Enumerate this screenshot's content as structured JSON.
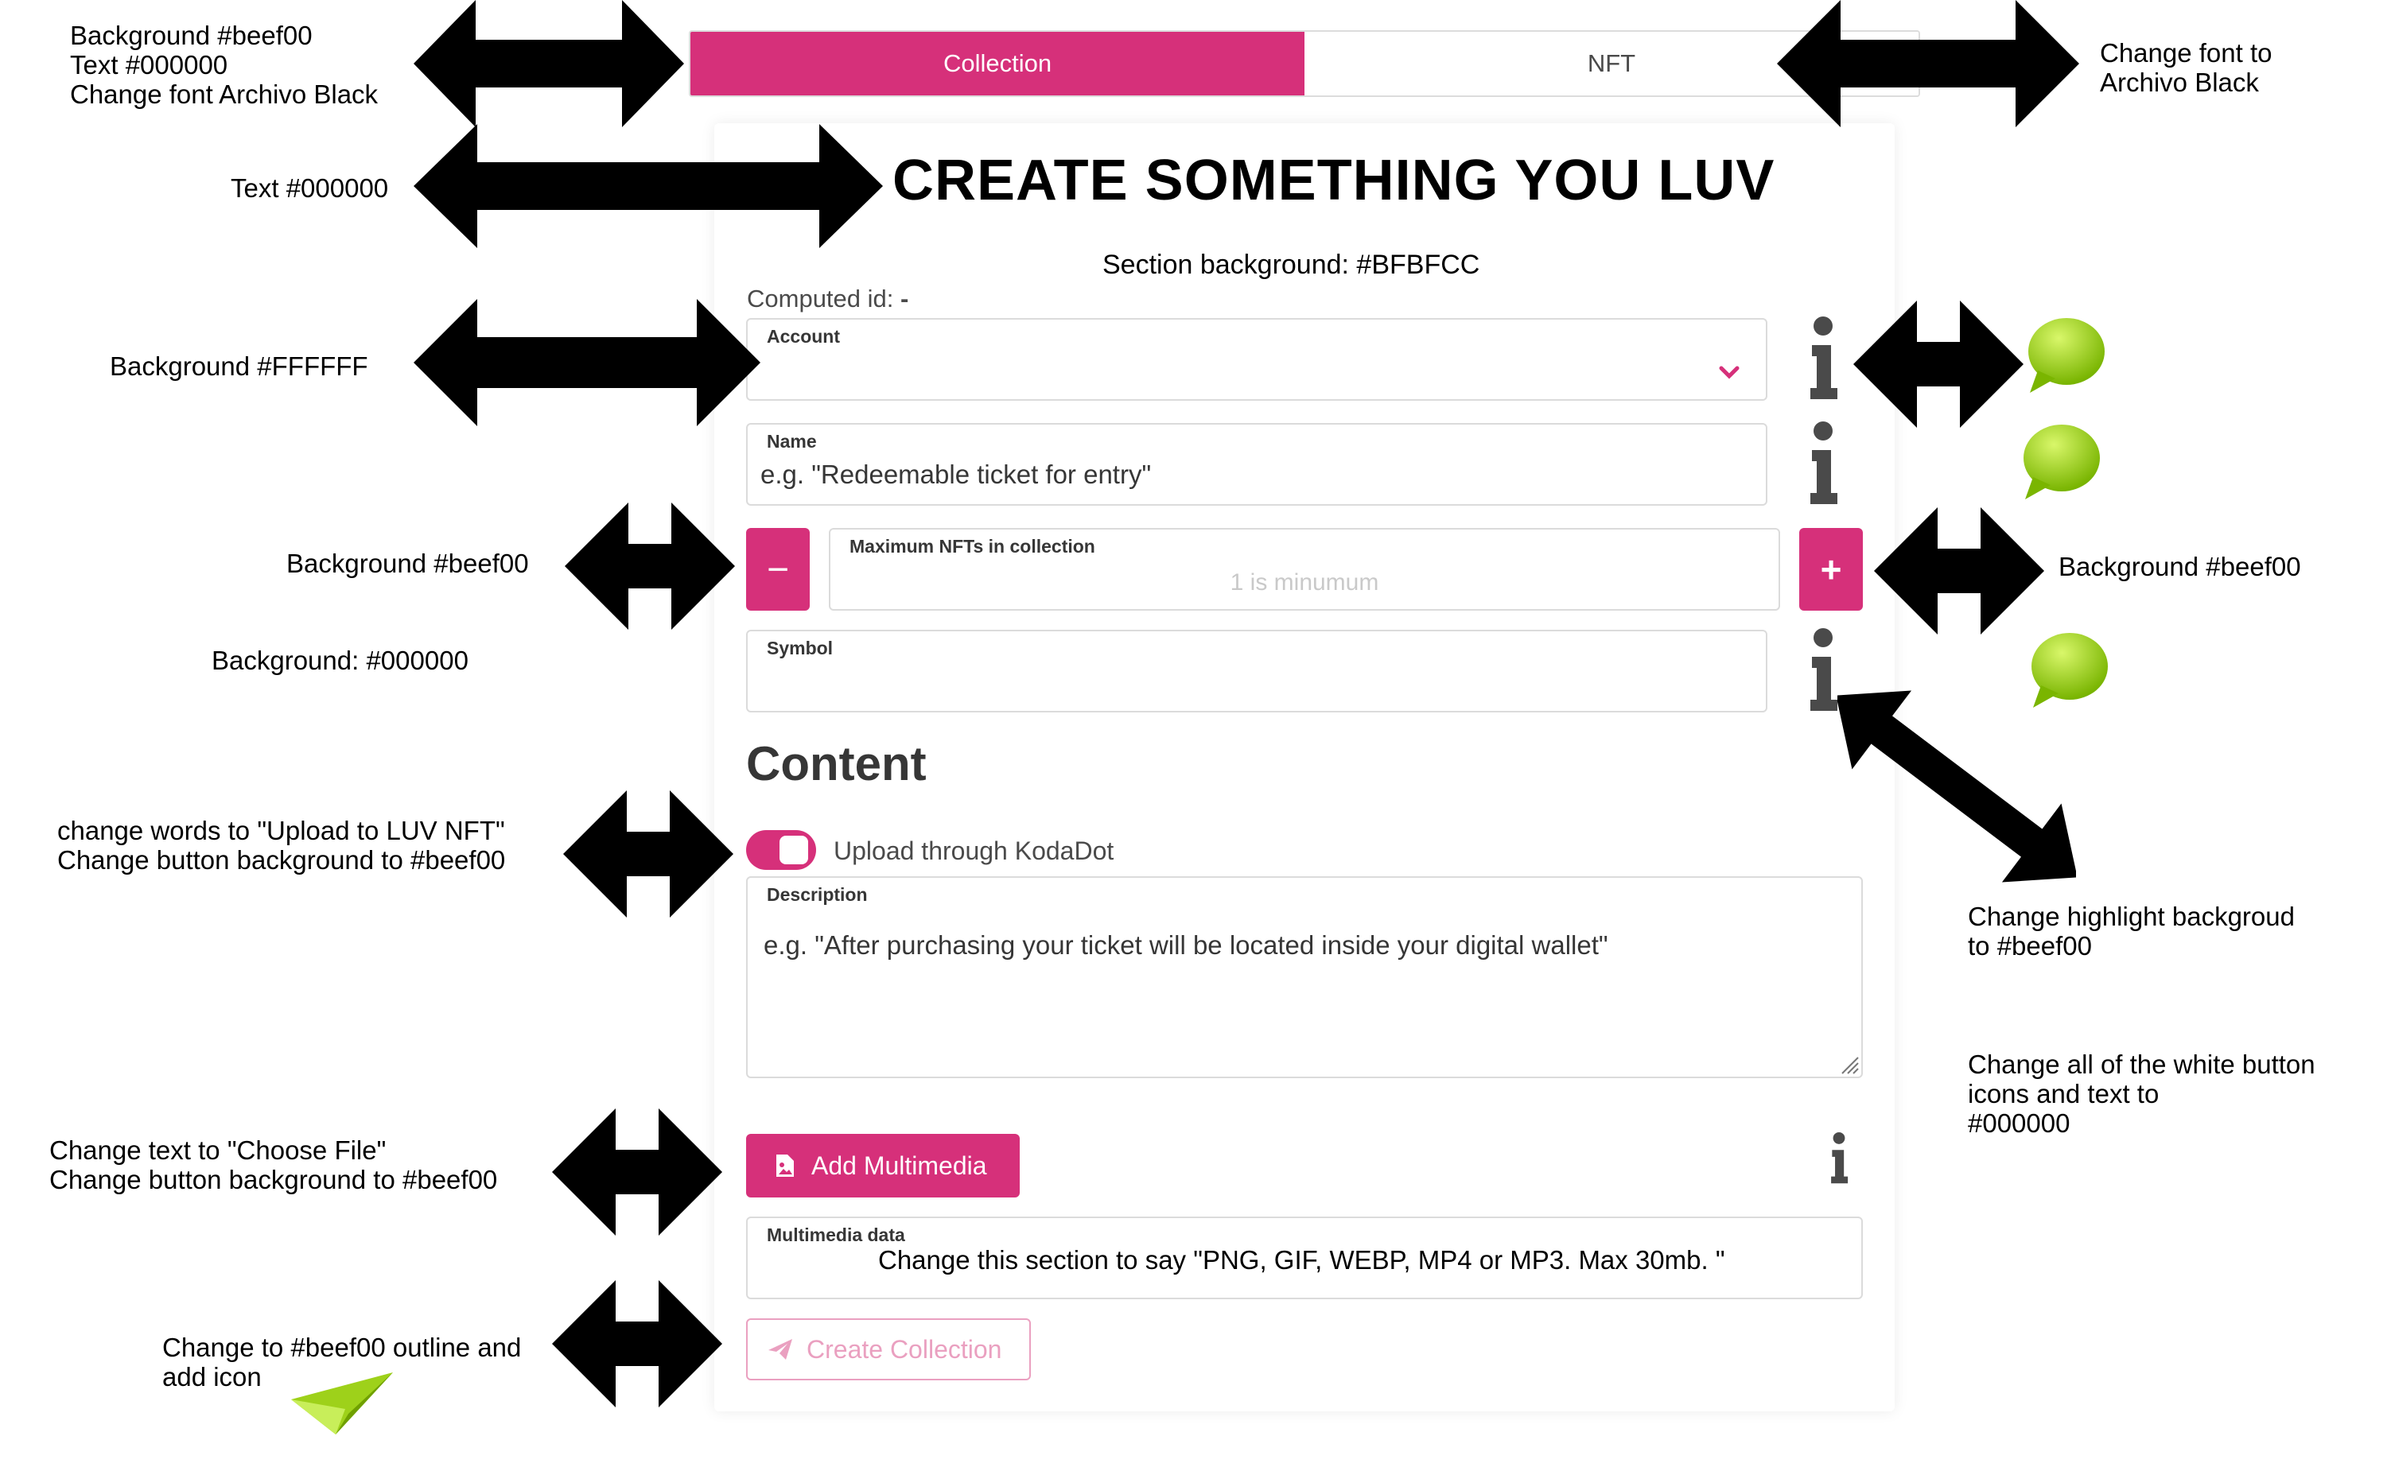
{
  "tabs": {
    "collection": "Collection",
    "nft": "NFT"
  },
  "form": {
    "title": "CREATE SOMETHING YOU LUV",
    "section_note": "Section background: #BFBFCC",
    "computed_id_label": "Computed id:",
    "computed_id_value": "-",
    "account": {
      "label": "Account",
      "value": ""
    },
    "name": {
      "label": "Name",
      "value": "e.g. \"Redeemable ticket for entry\""
    },
    "max_nfts": {
      "label": "Maximum NFTs in collection",
      "placeholder": "1 is minumum",
      "minus": "−",
      "plus": "+"
    },
    "symbol": {
      "label": "Symbol",
      "value": ""
    },
    "content_heading": "Content",
    "upload_toggle_label": "Upload through KodaDot",
    "description": {
      "label": "Description",
      "value": "e.g. \"After purchasing your ticket will be located inside your digital wallet\""
    },
    "add_multimedia": "Add Multimedia",
    "multimedia": {
      "label": "Multimedia data",
      "value": "Change this section to say \"PNG, GIF, WEBP, MP4 or MP3. Max 30mb. \""
    },
    "create_collection": "Create Collection"
  },
  "annotations": {
    "tab_note_l1": "Background #beef00",
    "tab_note_l2": "Text #000000",
    "tab_note_l3": "Change font Archivo Black",
    "nft_note_l1": "Change font to",
    "nft_note_l2": "Archivo Black",
    "title_note": "Text #000000",
    "account_note": "Background #FFFFFF",
    "minus_note": "Background #beef00",
    "plus_note": "Background #beef00",
    "symbol_note": "Background: #000000",
    "toggle_note_l1": "change words to \"Upload to LUV NFT\"",
    "toggle_note_l2": "Change button background to #beef00",
    "highlight_note_l1": "Change highlight backgroud",
    "highlight_note_l2": "to #beef00",
    "white_note_l1": "Change all of the white button",
    "white_note_l2": "icons and text to",
    "white_note_l3": "#000000",
    "multimedia_note_l1": "Change text to \"Choose File\"",
    "multimedia_note_l2": "Change button background to #beef00",
    "create_note_l1": "Change to #beef00 outline and",
    "create_note_l2": "add icon"
  },
  "colors": {
    "accent": "#d6307a",
    "lime": "#8fcf00",
    "arrow": "#000000"
  },
  "icons": [
    "info-icon",
    "chat-bubble-icon",
    "double-arrow-icon",
    "paper-plane-icon",
    "chevron-down-icon",
    "file-image-icon"
  ]
}
